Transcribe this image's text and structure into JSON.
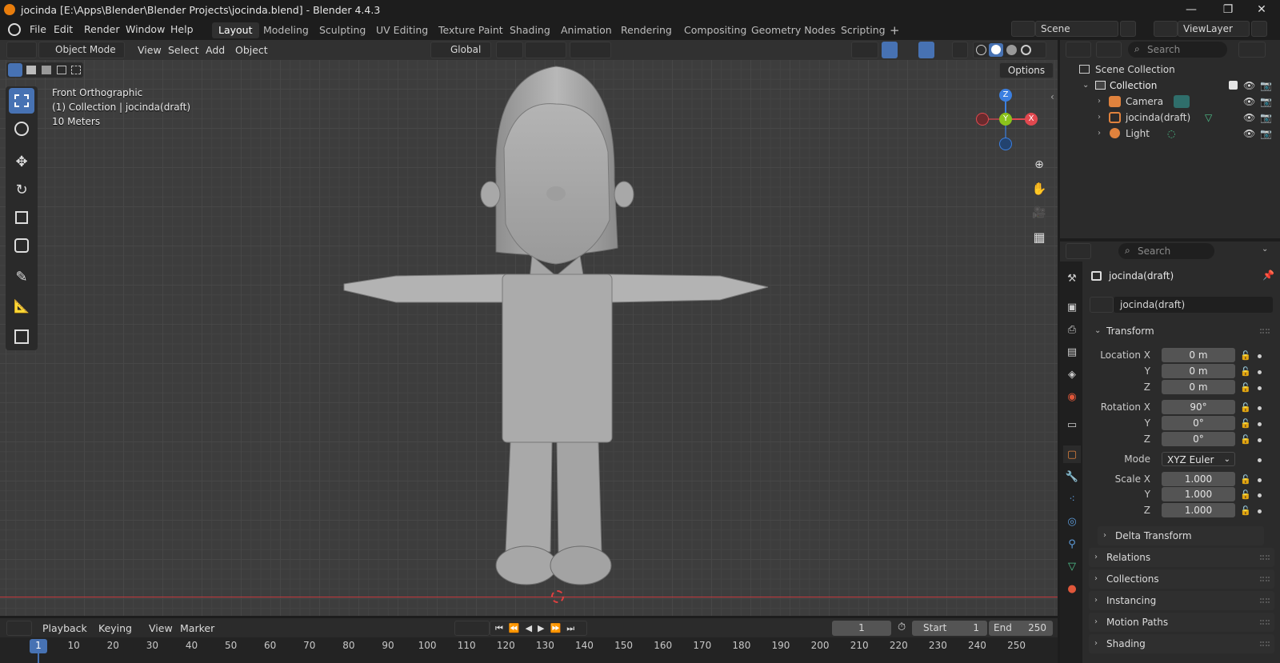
{
  "window": {
    "title": "jocinda [E:\\Apps\\Blender\\Blender Projects\\jocinda.blend] - Blender 4.4.3",
    "min": "—",
    "max": "❐",
    "close": "✕"
  },
  "menu": {
    "items": [
      "File",
      "Edit",
      "Render",
      "Window",
      "Help"
    ]
  },
  "workspaces": [
    "Layout",
    "Modeling",
    "Sculpting",
    "UV Editing",
    "Texture Paint",
    "Shading",
    "Animation",
    "Rendering",
    "Compositing",
    "Geometry Nodes",
    "Scripting",
    "+"
  ],
  "scene": {
    "scene_name": "Scene",
    "view_layer": "ViewLayer"
  },
  "viewport": {
    "mode": "Object Mode",
    "menus": [
      "View",
      "Select",
      "Add",
      "Object"
    ],
    "orientation": "Global",
    "options_label": "Options",
    "overlay_view": "Front Orthographic",
    "overlay_collection": "(1) Collection | jocinda(draft)",
    "overlay_scale": "10 Meters",
    "gizmo": {
      "z": "Z",
      "y": "Y",
      "x": "X"
    }
  },
  "outliner": {
    "search_placeholder": "Search",
    "scene_collection": "Scene Collection",
    "collection": "Collection",
    "items": [
      {
        "name": "Camera"
      },
      {
        "name": "jocinda(draft)"
      },
      {
        "name": "Light"
      }
    ]
  },
  "properties": {
    "search_placeholder": "Search",
    "object_name": "jocinda(draft)",
    "object_field": "jocinda(draft)",
    "transform_label": "Transform",
    "location": {
      "label": "Location X",
      "x": "0 m",
      "y": "0 m",
      "z": "0 m"
    },
    "rotation": {
      "label": "Rotation X",
      "x": "90°",
      "y": "0°",
      "z": "0°"
    },
    "mode": {
      "label": "Mode",
      "value": "XYZ Euler"
    },
    "scale": {
      "label": "Scale X",
      "x": "1.000",
      "y": "1.000",
      "z": "1.000"
    },
    "y_label": "Y",
    "z_label": "Z",
    "panels": [
      "Delta Transform",
      "Relations",
      "Collections",
      "Instancing",
      "Motion Paths",
      "Shading"
    ]
  },
  "timeline": {
    "menus": [
      "Playback",
      "Keying",
      "View",
      "Marker"
    ],
    "current_frame": "1",
    "start_label": "Start",
    "start": "1",
    "end_label": "End",
    "end": "250",
    "ticks": [
      "1",
      "10",
      "20",
      "30",
      "40",
      "50",
      "60",
      "70",
      "80",
      "90",
      "100",
      "110",
      "120",
      "130",
      "140",
      "150",
      "160",
      "170",
      "180",
      "190",
      "200",
      "210",
      "220",
      "230",
      "240",
      "250"
    ]
  },
  "colors": {
    "accent": "#4772b3",
    "x_axis": "#e1484f",
    "y_axis": "#8bc21c",
    "z_axis": "#3b7fe0",
    "frame_marker": "#4772b3"
  }
}
